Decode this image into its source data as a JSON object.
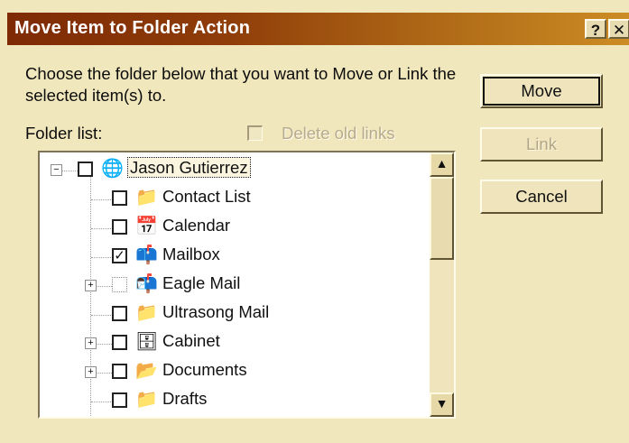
{
  "window": {
    "title": "Move Item to Folder Action",
    "help_label": "?",
    "close_label": "✕"
  },
  "prompt": "Choose the folder below that you want to Move or Link the selected item(s) to.",
  "folder_list_label": "Folder list:",
  "delete_old_links": {
    "label": "Delete old links",
    "checked": false,
    "enabled": false
  },
  "buttons": {
    "move": "Move",
    "link": "Link",
    "cancel": "Cancel"
  },
  "tree": {
    "items": [
      {
        "label": "Jason Gutierrez",
        "icon": "globe-icon",
        "glyph": "🌐",
        "checked": false,
        "expandable": true,
        "expanded": true
      },
      {
        "label": "Contact List",
        "icon": "folder-icon",
        "glyph": "📁",
        "checked": false,
        "expandable": false
      },
      {
        "label": "Calendar",
        "icon": "calendar-icon",
        "glyph": "📅",
        "checked": false,
        "expandable": false
      },
      {
        "label": "Mailbox",
        "icon": "mailbox-icon",
        "glyph": "📫",
        "checked": true,
        "expandable": false
      },
      {
        "label": "Eagle Mail",
        "icon": "mail-account-icon",
        "glyph": "📬",
        "checked": false,
        "expandable": true,
        "dotted_checkbox": true
      },
      {
        "label": "Ultrasong Mail",
        "icon": "folder-icon",
        "glyph": "📁",
        "checked": false,
        "expandable": false
      },
      {
        "label": "Cabinet",
        "icon": "cabinet-icon",
        "glyph": "🗄",
        "checked": false,
        "expandable": true
      },
      {
        "label": "Documents",
        "icon": "documents-folder-icon",
        "glyph": "📂",
        "checked": false,
        "expandable": true
      },
      {
        "label": "Drafts",
        "icon": "folder-icon",
        "glyph": "📁",
        "checked": false,
        "expandable": false
      }
    ],
    "scroll": {
      "up_label": "▲",
      "down_label": "▼"
    }
  }
}
